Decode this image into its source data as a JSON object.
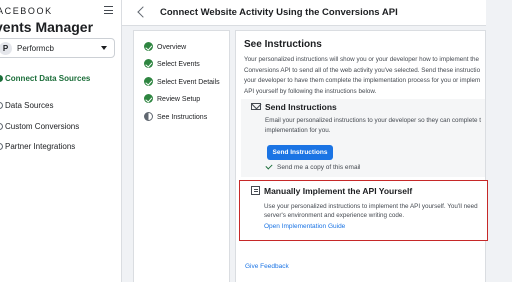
{
  "sidebar": {
    "brand": "ACEBOOK",
    "app_title": "vents Manager",
    "account": {
      "initial": "P",
      "name": "Performcb"
    },
    "items": [
      {
        "label": "Connect Data Sources",
        "active": true
      },
      {
        "label": "Data Sources"
      },
      {
        "label": "Custom Conversions"
      },
      {
        "label": "Partner Integrations"
      }
    ]
  },
  "header": {
    "title": "Connect Website Activity Using the Conversions API"
  },
  "steps": [
    {
      "label": "Overview",
      "status": "complete"
    },
    {
      "label": "Select Events",
      "status": "complete"
    },
    {
      "label": "Select Event Details",
      "status": "complete"
    },
    {
      "label": "Review Setup",
      "status": "complete"
    },
    {
      "label": "See Instructions",
      "status": "current"
    }
  ],
  "main": {
    "title": "See Instructions",
    "description": [
      "Your personalized instructions will show you or your developer how to implement the",
      "Conversions API to send all of the web activity you've selected. Send these instructio",
      "your developer to have them complete the implementation process for you or implem",
      "API yourself by following the instructions below."
    ],
    "send": {
      "title": "Send Instructions",
      "text": [
        "Email your personalized instructions to your developer so they can complete t",
        "implementation for you."
      ],
      "button": "Send Instructions",
      "copy_label": "Send me a copy of this email"
    },
    "manual": {
      "title": "Manually Implement the API Yourself",
      "text": [
        "Use your personalized instructions to implement the API yourself. You'll need",
        "server's environment and experience writing code."
      ],
      "link": "Open Implementation Guide"
    },
    "feedback": "Give Feedback"
  },
  "colors": {
    "accent": "#1b74e4",
    "success": "#2e8540",
    "highlight_border": "#c62828",
    "active_nav": "#1c6e3a"
  }
}
